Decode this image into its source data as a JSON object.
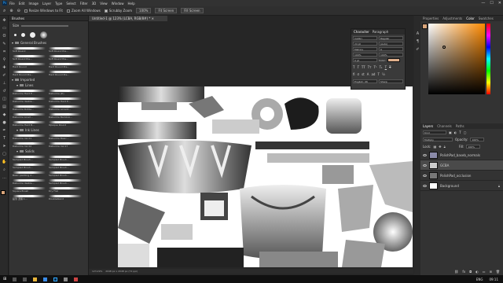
{
  "menu": [
    "File",
    "Edit",
    "Image",
    "Layer",
    "Type",
    "Select",
    "Filter",
    "3D",
    "View",
    "Window",
    "Help"
  ],
  "window_controls": [
    "—",
    "☐",
    "✕"
  ],
  "options": {
    "checkbox1": "Resize Windows to Fit",
    "checkbox2": "Zoom All Windows",
    "checkbox3": "Scrubby Zoom",
    "zoom_value": "100%",
    "fit_screen": "Fit Screen",
    "fill_screen": "Fill Screen"
  },
  "tools": [
    "move-icon",
    "marquee-icon",
    "lasso-icon",
    "quick-select-icon",
    "crop-icon",
    "eyedropper-icon",
    "healing-icon",
    "brush-icon",
    "stamp-icon",
    "history-brush-icon",
    "eraser-icon",
    "gradient-icon",
    "blur-icon",
    "dodge-icon",
    "pen-icon",
    "type-icon",
    "path-select-icon",
    "shape-icon",
    "hand-icon",
    "zoom-icon"
  ],
  "brushes": {
    "title": "Brushes",
    "size": "Size",
    "group1": "General Brushes",
    "general_rows": [
      [
        "Soft Round",
        "Soft Round Pre..."
      ],
      [
        "Soft Round Pre...",
        "Soft Round Pre..."
      ],
      [
        "Hard Round",
        "Hard Round Pre..."
      ],
      [
        "Hard Round Pre...",
        "Hard Round Pre..."
      ]
    ],
    "group2": "Imported",
    "sub1": "Lines",
    "lines_rows": [
      [
        "Daburme Hard E...",
        "Daburme (D)"
      ],
      [
        "Daburme dsable...",
        "Daburme Hard E..."
      ],
      [
        "Daburme Dotde...",
        "Daburme accent..."
      ],
      [
        "Daburme Linerl...",
        "Daburme Bamboo..."
      ],
      [
        "Daburme Hard B...",
        "Opaque Round"
      ]
    ],
    "sub2": "Ink Lines",
    "ink_rows": [
      [
        "Daburme Ink 01",
        "Daburme Basic..."
      ],
      [
        "Daburme Ink 02",
        "Daburme Ink 07"
      ]
    ],
    "sub3": "Solids",
    "solids_rows": [
      [
        "Sampled Brush...",
        "Sampled Brush..."
      ],
      [
        "Sampled Brush...",
        "Sampled Brush..."
      ],
      [
        "Basic painting d...",
        "Sampled Brush..."
      ],
      [
        "Daburme dsable...",
        "Sampled Brush..."
      ],
      [
        "Square Brush",
        "Dry Flat"
      ],
      [
        "鉛筆 濃黒 1...",
        "Doubleblend"
      ]
    ]
  },
  "document": {
    "tab": "Untitled-1 @ 123% (LCBA, RGB/8#) *",
    "status_zoom": "123.29%",
    "status_info": "2048 px x 2048 px (72 ppi)"
  },
  "character": {
    "tabs": [
      "Character",
      "Paragraph"
    ],
    "font": "Calibri",
    "style": "Regular",
    "size": "24 pt",
    "leading": "(Auto)",
    "tracking": "0",
    "kerning": "Metrics",
    "vscale": "100%",
    "hscale": "100%",
    "baseline": "0 pt",
    "color_label": "Color:",
    "language": "English: UK",
    "aa": "Sharp"
  },
  "right": {
    "top_tabs": [
      "Properties",
      "Adjustments",
      "Color",
      "Swatches"
    ],
    "active_top": "Color",
    "layers_tabs": [
      "Layers",
      "Channels",
      "Paths"
    ],
    "blend_mode": "Multiply",
    "opacity_label": "Opacity:",
    "opacity": "100%",
    "fill_label": "Fill:",
    "fill": "100%",
    "lock_label": "Lock:",
    "kind": "Kind",
    "layers": [
      {
        "name": "PolishPad_baseb_normals"
      },
      {
        "name": "GCBA"
      },
      {
        "name": "PolishPad_occlusion"
      },
      {
        "name": "Background"
      }
    ]
  },
  "colors": {
    "accent": "#31a8ff",
    "foreground": "#d9a57a",
    "background": "#ffffff",
    "color_swatch": "#e0b08c"
  },
  "taskbar": {
    "lang": "ENG",
    "time": "09:11"
  }
}
